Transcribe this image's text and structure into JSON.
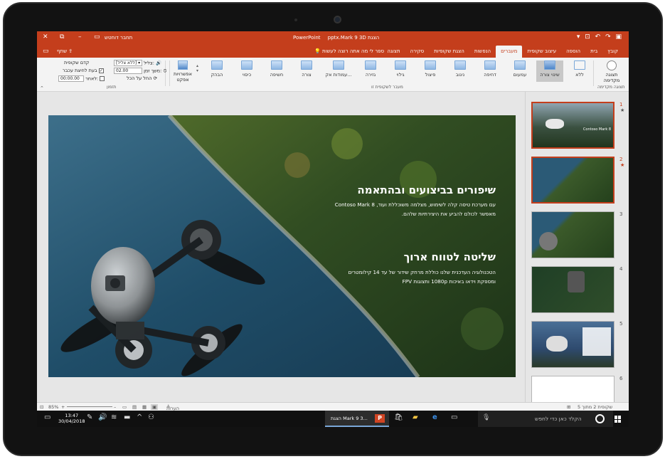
{
  "window": {
    "title_app": "PowerPoint",
    "title_file": "pptx.Mark 9 3D הצגת",
    "sign_in": "תחבר דוחטש",
    "minimize": "–",
    "restore": "⧉",
    "close": "✕"
  },
  "tabs": [
    {
      "label": "קובץ"
    },
    {
      "label": "בית"
    },
    {
      "label": "הוספה"
    },
    {
      "label": "עיצוב שקופית"
    },
    {
      "label": "מעברים",
      "active": true
    },
    {
      "label": "הנפשות"
    },
    {
      "label": "הצגת שקופיות"
    },
    {
      "label": "סקירה"
    },
    {
      "label": "תצוגה"
    }
  ],
  "tell_me": "ספר לי מה אתה רוצה לעשות",
  "share": "שתף",
  "ribbon": {
    "preview": "תצוגה מקדימה",
    "preview_group": "תצוגה מקדימה",
    "transitions_group": "מעבר לשקופית זו",
    "timing_group": "תזמון",
    "transitions": [
      {
        "label": "ללא"
      },
      {
        "label": "שינוי צורה",
        "selected": true
      },
      {
        "label": "עמעום"
      },
      {
        "label": "דחיפה"
      },
      {
        "label": "ניגוב"
      },
      {
        "label": "פיצול"
      },
      {
        "label": "גילוי"
      },
      {
        "label": "גזירה"
      },
      {
        "label": "עמודות אק..."
      },
      {
        "label": "צורה"
      },
      {
        "label": "חשיפה"
      },
      {
        "label": "כיסוי"
      },
      {
        "label": "הבהק"
      }
    ],
    "effect_options": "אפשרויות אפקט",
    "sound_label": "צליל:",
    "sound_value": "[ללא צליל]",
    "duration_label": "משך זמן:",
    "duration_value": "02.00",
    "apply_all": "החל על הכל",
    "advance_label": "קדם שקופית",
    "on_click": "בעת לחיצת עכבר",
    "after_label": "לאחר:",
    "after_value": "00:00.00"
  },
  "slide": {
    "heading1": "שיפורים בביצועים ובהתאמה",
    "para1_line1": "עם מערכת טיסה קלה לשימוש, מצלמה משוכללת ועוד, Contoso Mark 8",
    "para1_line2": "מאפשר לכולם להביע את היצירתיות שלהם.",
    "heading2": "שליטה לטווח ארוך",
    "para2_line1": "הטכנולוגיה העדכנית שלנו כוללת מרחק שידור של עד 14 קילומטרים",
    "para2_line2": "ומספקת וידאו באיכות 1080p ותצוגות FPV"
  },
  "thumbnails": [
    {
      "num": "1",
      "star": "★",
      "selected": false,
      "caption": "Contoso Mark 8"
    },
    {
      "num": "2",
      "star": "★",
      "selected": true
    },
    {
      "num": "3"
    },
    {
      "num": "4"
    },
    {
      "num": "5"
    },
    {
      "num": "6"
    }
  ],
  "statusbar": {
    "slide_count": "שקופית 2 מתוך 5",
    "notes": "הערות",
    "zoom": "85%"
  },
  "taskbar": {
    "search_placeholder": "הקלד כאן כדי לחפש",
    "pp_task_label": "הצגת Mark 9 3...",
    "time": "13:47",
    "date": "30/04/2018"
  },
  "colors": {
    "accent": "#c43e1c",
    "ribbon_bg": "#f3f3f3",
    "taskbar_bg": "#101010"
  }
}
